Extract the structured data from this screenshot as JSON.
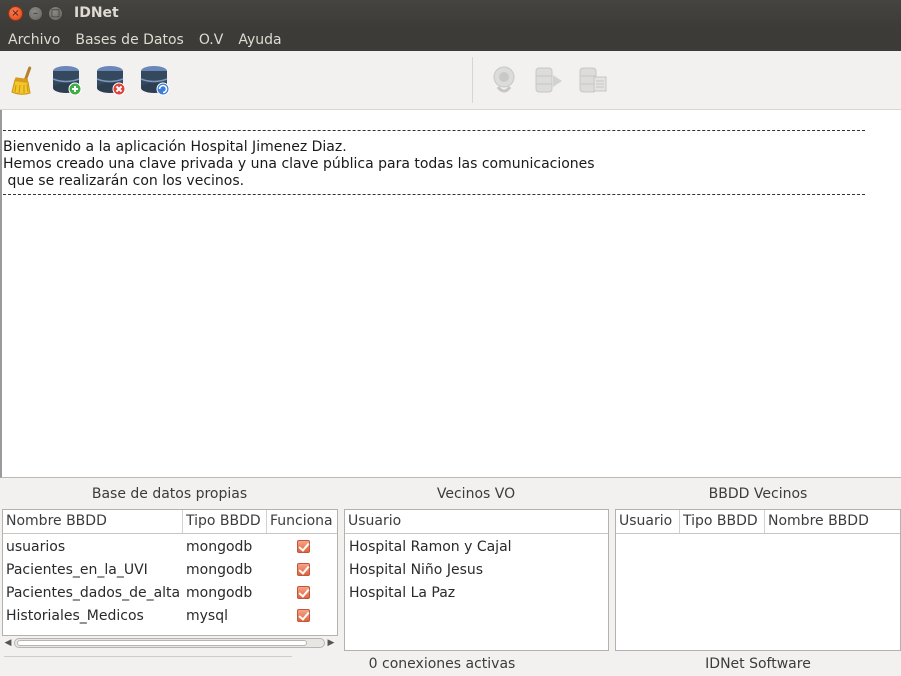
{
  "window": {
    "title": "IDNet"
  },
  "menu": [
    "Archivo",
    "Bases de Datos",
    "O.V",
    "Ayuda"
  ],
  "toolbar": {
    "icons": [
      "broom-icon",
      "database-add-icon",
      "database-remove-icon",
      "database-refresh-icon",
      "connect-icon",
      "database-export-icon",
      "database-list-icon"
    ]
  },
  "log": {
    "rule": "",
    "lines": [
      "Bienvenido a la aplicación Hospital Jimenez Diaz.",
      "Hemos creado una clave privada y una clave pública para todas las comunicaciones",
      " que se realizarán con los vecinos."
    ]
  },
  "own_db": {
    "title": "Base de datos propias",
    "headers": [
      "Nombre BBDD",
      "Tipo BBDD",
      "Funciona"
    ],
    "rows": [
      {
        "name": "usuarios",
        "type": "mongodb",
        "works": true
      },
      {
        "name": "Pacientes_en_la_UVI",
        "type": "mongodb",
        "works": true
      },
      {
        "name": "Pacientes_dados_de_alta",
        "type": "mongodb",
        "works": true
      },
      {
        "name": "Historiales_Medicos",
        "type": "mysql",
        "works": true
      }
    ]
  },
  "neighbors": {
    "title": "Vecinos VO",
    "headers": [
      "Usuario"
    ],
    "rows": [
      "Hospital Ramon y Cajal",
      "Hospital Niño Jesus",
      "Hospital La Paz"
    ]
  },
  "neighbor_db": {
    "title": "BBDD Vecinos",
    "headers": [
      "Usuario",
      "Tipo BBDD",
      "Nombre BBDD"
    ]
  },
  "status": {
    "connections": "0 conexiones activas",
    "software": "IDNet Software"
  },
  "colors": {
    "titlebar": "#3c3b37",
    "checkbox": "#e1623c",
    "close_button": "#e2470e"
  }
}
